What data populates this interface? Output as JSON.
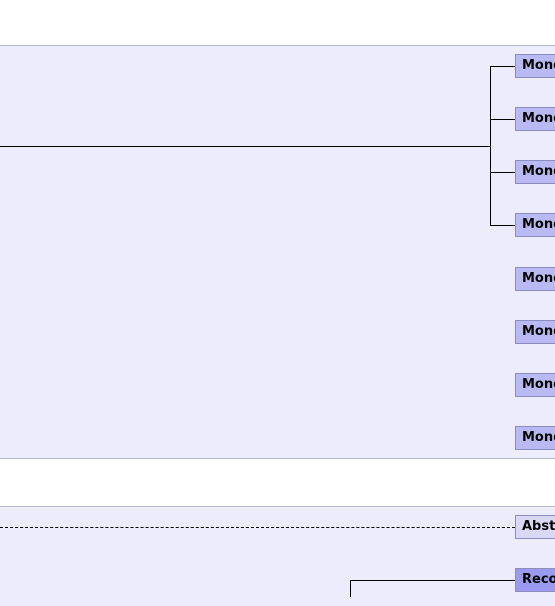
{
  "group1": {
    "nodes": [
      {
        "label": "Mono"
      },
      {
        "label": "Mono"
      },
      {
        "label": "Mono"
      },
      {
        "label": "Mono"
      },
      {
        "label": "Mono"
      },
      {
        "label": "Mono"
      },
      {
        "label": "Mono"
      },
      {
        "label": "Mono"
      }
    ]
  },
  "group2": {
    "nodes": [
      {
        "label": "Abst"
      },
      {
        "label": "Reco"
      }
    ]
  },
  "colors": {
    "band_fill": "#ececfc",
    "node_fill": "#b9b9f4",
    "abstract_fill": "#d9d9f7",
    "record_fill": "#9a9af0"
  }
}
